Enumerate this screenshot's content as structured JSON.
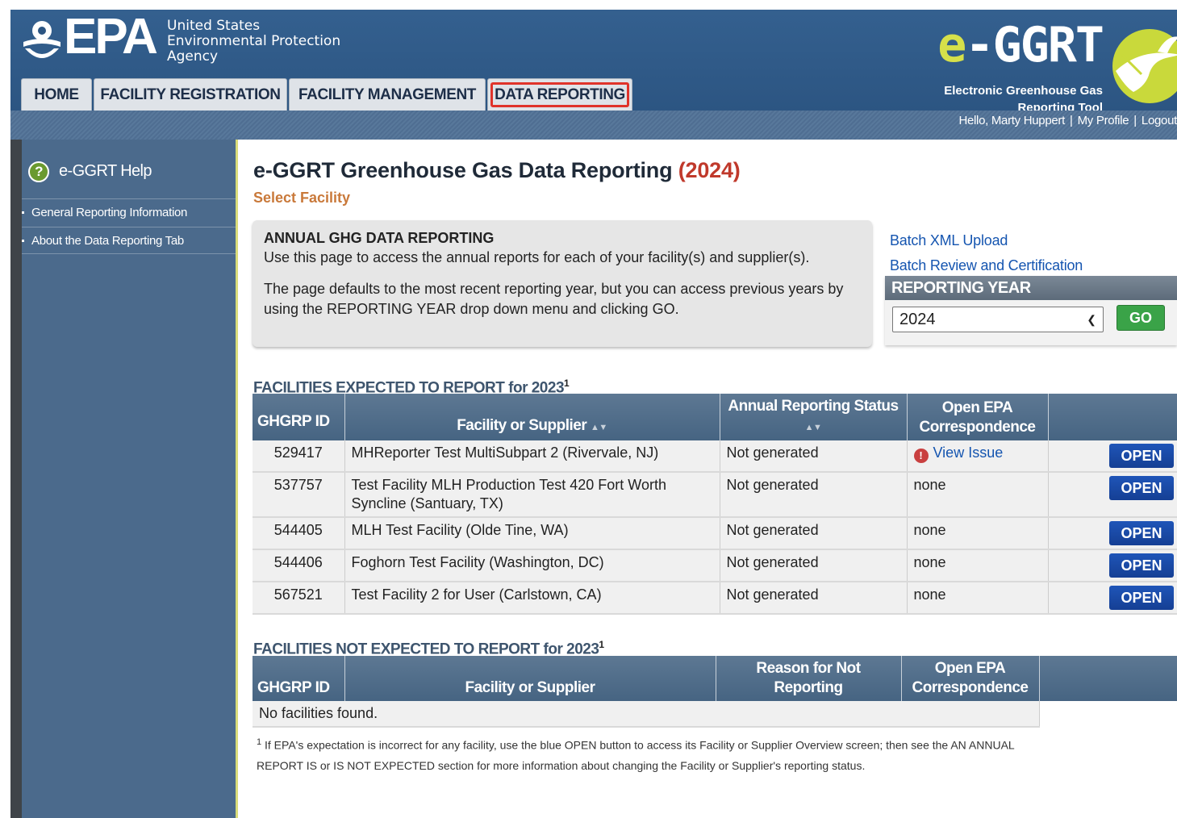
{
  "header": {
    "agency_logo": "EPA",
    "agency_line1": "United States",
    "agency_line2": "Environmental Protection",
    "agency_line3": "Agency",
    "brand_e": "e",
    "brand_rest": "-GGRT",
    "brand_sub1": "Electronic Greenhouse Gas",
    "brand_sub2": "Reporting Tool"
  },
  "tabs": [
    {
      "label": "HOME"
    },
    {
      "label": "FACILITY REGISTRATION"
    },
    {
      "label": "FACILITY MANAGEMENT"
    },
    {
      "label": "DATA REPORTING",
      "active": true
    }
  ],
  "user": {
    "greeting": "Hello, Marty Huppert",
    "profile": "My Profile",
    "logout": "Logout"
  },
  "sidebar": {
    "help": "e-GGRT Help",
    "items": [
      {
        "label": "General Reporting Information"
      },
      {
        "label": "About the Data Reporting Tab"
      }
    ]
  },
  "main": {
    "title": "e-GGRT Greenhouse Gas Data Reporting",
    "title_year": "(2024)",
    "subtitle": "Select Facility",
    "info_heading": "ANNUAL GHG DATA REPORTING",
    "info_p1": "Use this page to access the annual reports for each of your facility(s) and supplier(s).",
    "info_p2": "The page defaults to the most recent reporting year, but you can access previous years by using the REPORTING YEAR drop down menu and clicking GO.",
    "batch_upload": "Batch XML Upload",
    "batch_review": "Batch Review and Certification",
    "reporting_year_label": "REPORTING YEAR",
    "reporting_year_value": "2024",
    "go_label": "GO"
  },
  "expected": {
    "title": "FACILITIES EXPECTED TO REPORT for 2023",
    "footnote_marker": "1",
    "headers": {
      "id": "GHGRP ID",
      "facility": "Facility or Supplier",
      "status": "Annual Reporting Status",
      "correspondence": "Open EPA Correspondence"
    },
    "rows": [
      {
        "id": "529417",
        "facility": "MHReporter Test MultiSubpart 2 (Rivervale, NJ)",
        "status": "Not generated",
        "correspondence": "View Issue",
        "action": "OPEN"
      },
      {
        "id": "537757",
        "facility": "Test Facility MLH Production Test 420 Fort Worth Syncline (Santuary, TX)",
        "status": "Not generated",
        "correspondence": "none",
        "action": "OPEN"
      },
      {
        "id": "544405",
        "facility": "MLH Test Facility (Olde Tine, WA)",
        "status": "Not generated",
        "correspondence": "none",
        "action": "OPEN"
      },
      {
        "id": "544406",
        "facility": "Foghorn Test Facility (Washington, DC)",
        "status": "Not generated",
        "correspondence": "none",
        "action": "OPEN"
      },
      {
        "id": "567521",
        "facility": "Test Facility 2 for User (Carlstown, CA)",
        "status": "Not generated",
        "correspondence": "none",
        "action": "OPEN"
      }
    ]
  },
  "not_expected": {
    "title": "FACILITIES NOT EXPECTED TO REPORT for 2023",
    "footnote_marker": "1",
    "headers": {
      "id": "GHGRP ID",
      "facility": "Facility or Supplier",
      "reason": "Reason for Not Reporting",
      "correspondence": "Open EPA Correspondence"
    },
    "empty_text": "No facilities found."
  },
  "footnote": {
    "marker": "1",
    "text": "If EPA's expectation is incorrect for any facility, use the blue OPEN button to access its Facility or Supplier Overview screen; then see the AN ANNUAL REPORT IS or IS NOT EXPECTED section for more information about changing the Facility or Supplier's reporting status."
  }
}
